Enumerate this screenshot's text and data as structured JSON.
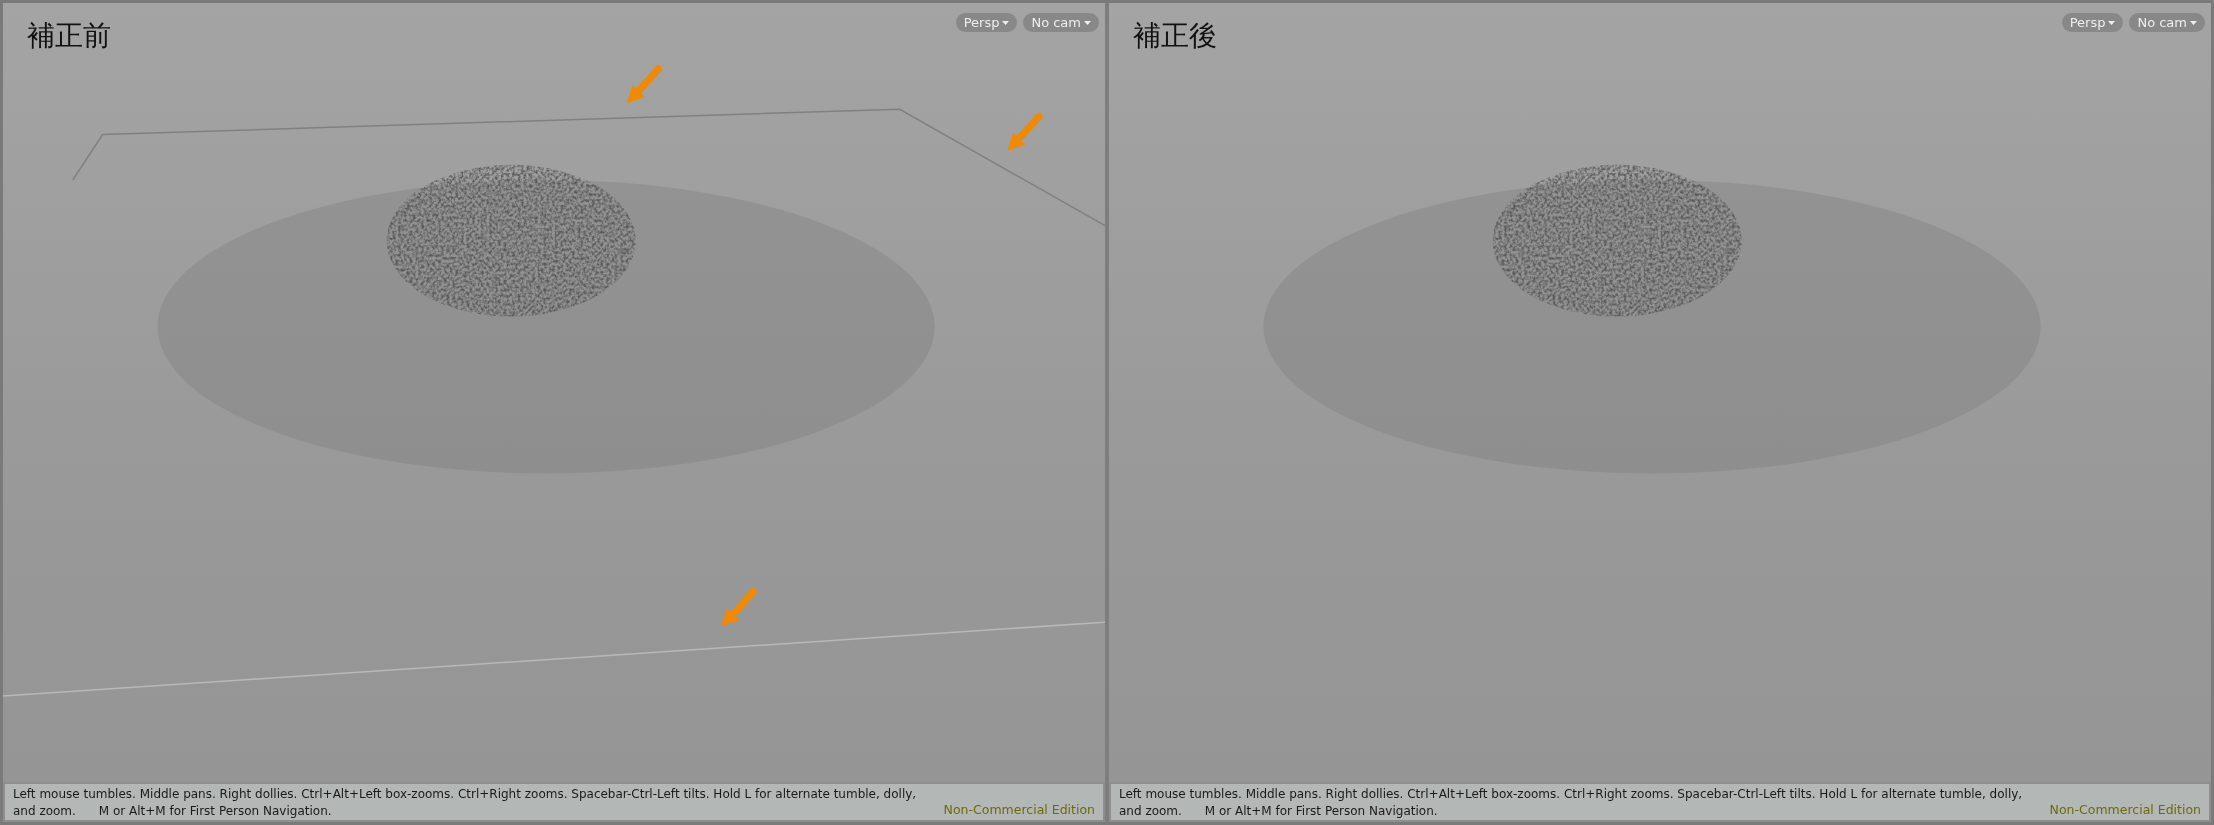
{
  "viewports": [
    {
      "label": "補正前",
      "annotated": true,
      "menus": [
        {
          "label": "Persp",
          "kind": "dropdown"
        },
        {
          "label": "No cam",
          "kind": "dropdown"
        }
      ],
      "status": {
        "hint": "Left mouse tumbles. Middle pans. Right dollies. Ctrl+Alt+Left box-zooms. Ctrl+Right zooms. Spacebar-Ctrl-Left tilts. Hold L for alternate tumble, dolly, and zoom.      M or Alt+M for First Person Navigation.",
        "edition": "Non-Commercial Edition"
      }
    },
    {
      "label": "補正後",
      "annotated": false,
      "menus": [
        {
          "label": "Persp",
          "kind": "dropdown"
        },
        {
          "label": "No cam",
          "kind": "dropdown"
        }
      ],
      "status": {
        "hint": "Left mouse tumbles. Middle pans. Right dollies. Ctrl+Alt+Left box-zooms. Ctrl+Right zooms. Spacebar-Ctrl-Left tilts. Hold L for alternate tumble, dolly, and zoom.      M or Alt+M for First Person Navigation.",
        "edition": "Non-Commercial Edition"
      }
    }
  ]
}
